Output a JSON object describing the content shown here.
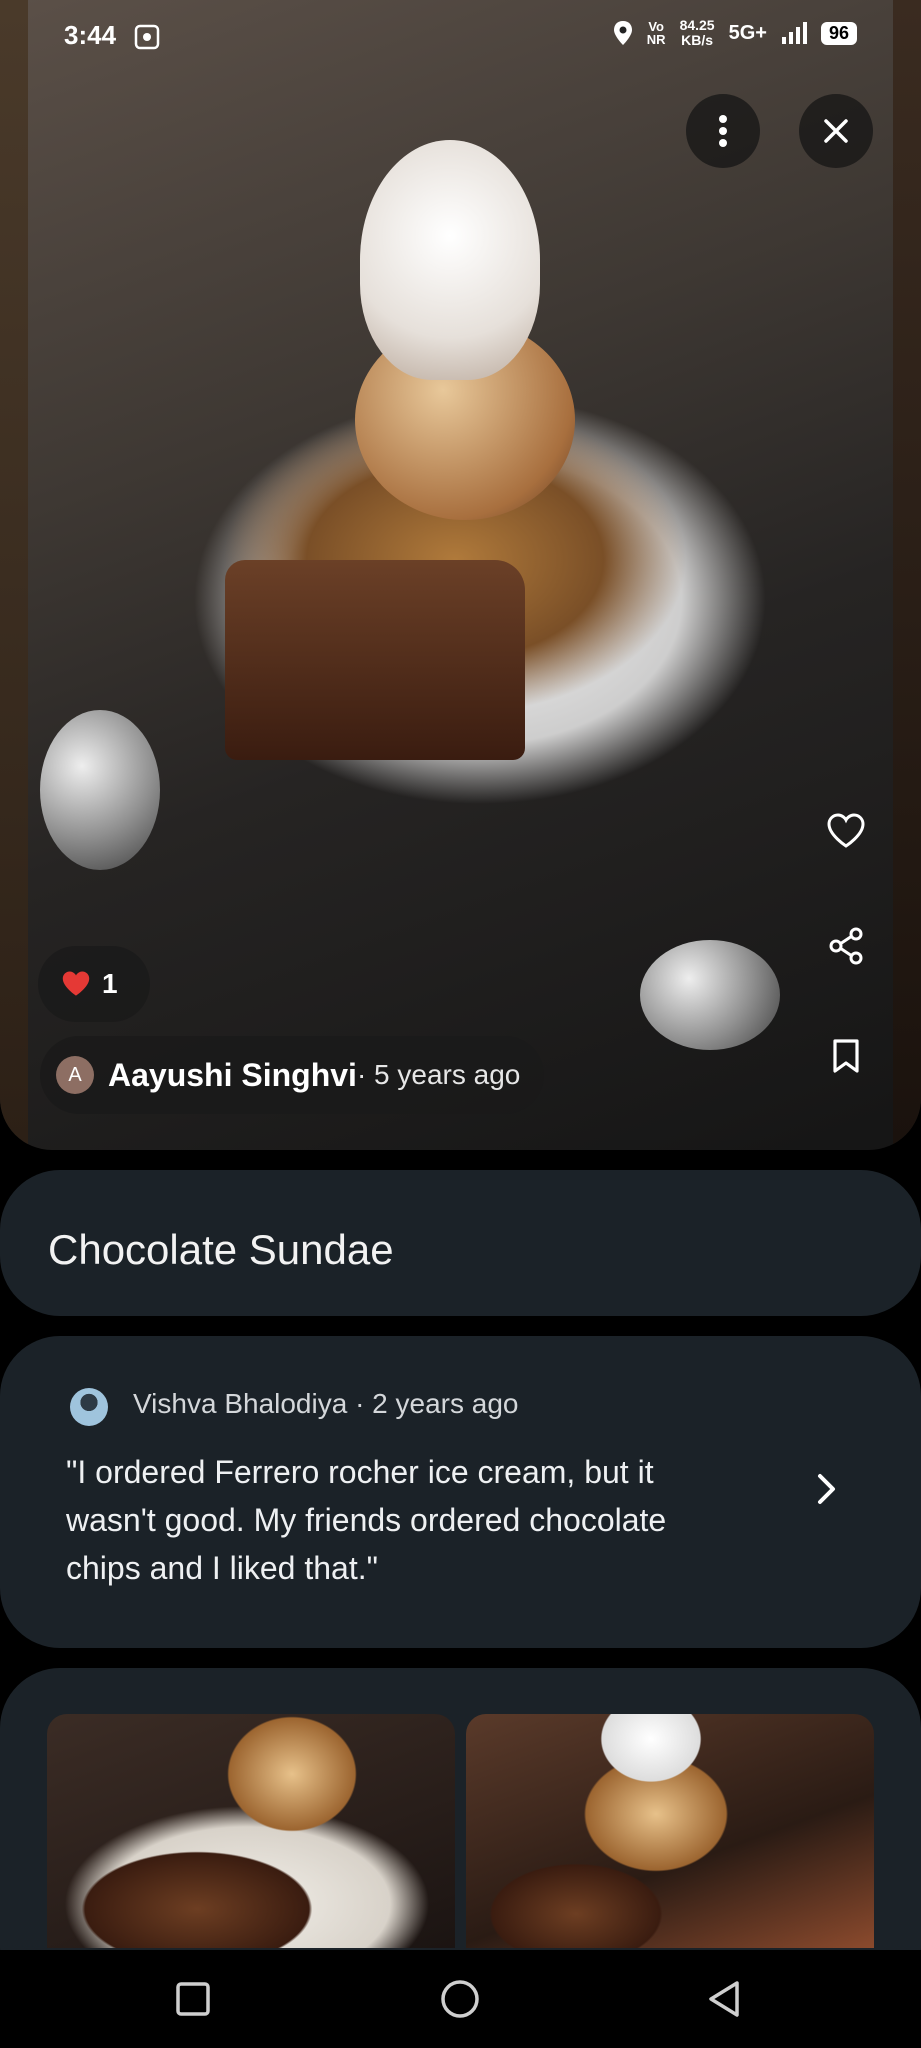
{
  "status_bar": {
    "time": "3:44",
    "network_speed_value": "84.25",
    "network_speed_unit": "KB/s",
    "volte_top": "Vo",
    "volte_bottom": "NR",
    "network_type": "5G+",
    "battery": "96",
    "icons": [
      "screenshot-icon",
      "location-icon",
      "signal-icon",
      "battery-icon"
    ]
  },
  "photo": {
    "description_icons": [
      "more-vertical-icon",
      "close-icon",
      "heart-outline-icon",
      "share-icon",
      "bookmark-icon"
    ],
    "likes": {
      "count": "1",
      "icon": "heart-filled-icon"
    },
    "author": {
      "initial": "A",
      "name": "Aayushi Singhvi",
      "time": " · 5 years ago"
    }
  },
  "dish_card": {
    "title": "Chocolate Sundae"
  },
  "review_card": {
    "reviewer": "Vishva Bhalodiya",
    "time": " · 2 years ago",
    "text": "\"I ordered Ferrero rocher ice cream, but it wasn't good. My friends ordered chocolate chips and I liked that.\"",
    "chevron_icon": "chevron-right-icon"
  },
  "gallery": {
    "thumbnails": [
      "photo-thumb-1",
      "photo-thumb-2"
    ]
  },
  "nav_bar": {
    "icons": [
      "recents-icon",
      "home-icon",
      "back-icon"
    ]
  },
  "colors": {
    "background": "#000000",
    "card": "#1b2228",
    "heart": "#e53935",
    "text_primary": "#f2f2f2"
  }
}
